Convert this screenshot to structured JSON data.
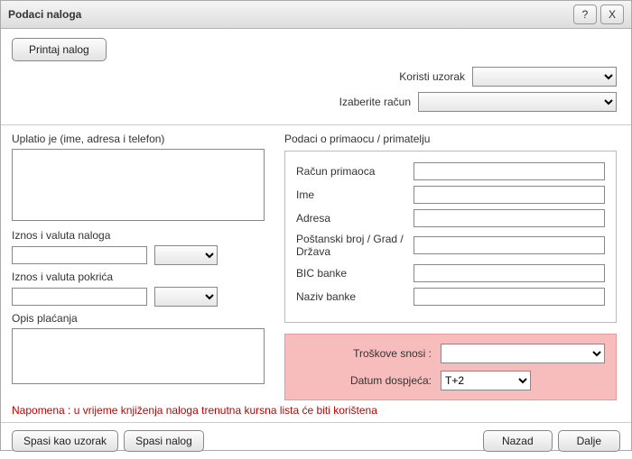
{
  "titlebar": {
    "title": "Podaci naloga",
    "help": "?",
    "close": "X"
  },
  "toolbar": {
    "print_label": "Printaj nalog"
  },
  "top": {
    "template_label": "Koristi uzorak",
    "account_label": "Izaberite račun"
  },
  "left": {
    "payer_label": "Uplatio je (ime, adresa i telefon)",
    "payer_value": "",
    "amount_order_label": "Iznos i valuta naloga",
    "amount_order_value": "",
    "amount_order_currency": "",
    "amount_cover_label": "Iznos i valuta pokrića",
    "amount_cover_value": "",
    "amount_cover_currency": "",
    "desc_label": "Opis plaćanja",
    "desc_value": ""
  },
  "right": {
    "section_label": "Podaci o primaocu / primatelju",
    "fields": {
      "account_label": "Račun primaoca",
      "account_value": "",
      "name_label": "Ime",
      "name_value": "",
      "address_label": "Adresa",
      "address_value": "",
      "postal_label": "Poštanski broj / Grad / Država",
      "postal_value": "",
      "bic_label": "BIC banke",
      "bic_value": "",
      "bank_label": "Naziv banke",
      "bank_value": ""
    },
    "cost": {
      "who_label": "Troškove snosi :",
      "who_value": "",
      "due_label": "Datum dospjeća:",
      "due_value": "T+2"
    }
  },
  "note": "Napomena : u vrijeme knjiženja naloga trenutna kursna lista će biti korištena",
  "footer": {
    "save_template": "Spasi kao uzorak",
    "save_order": "Spasi nalog",
    "back": "Nazad",
    "next": "Dalje"
  }
}
